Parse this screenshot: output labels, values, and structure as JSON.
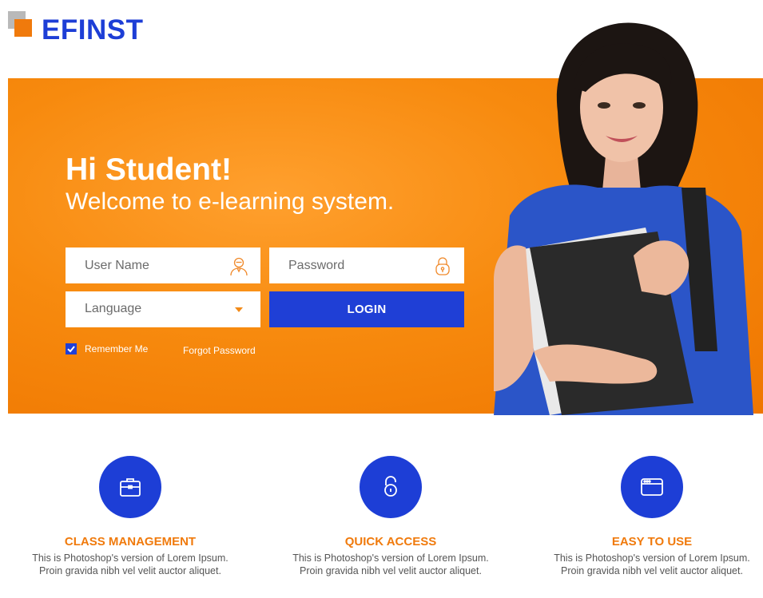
{
  "brand": {
    "name": "EFINST",
    "accent": "#f07a0c",
    "blue": "#1d3ed6"
  },
  "hero": {
    "greeting": "Hi Student!",
    "welcome": "Welcome to e-learning system.",
    "background": "#f78a0e",
    "image": "student-photo"
  },
  "form": {
    "username_placeholder": "User Name",
    "password_placeholder": "Password",
    "language_value": "Language",
    "login_label": "LOGIN",
    "remember_label": "Remember Me",
    "remember_checked": true,
    "forgot_label": "Forgot Password"
  },
  "features": [
    {
      "icon": "briefcase-icon",
      "title": "CLASS MANAGEMENT",
      "desc": "This is Photoshop's version  of Lorem Ipsum. Proin gravida nibh vel velit auctor aliquet."
    },
    {
      "icon": "unlock-icon",
      "title": "QUICK ACCESS",
      "desc": "This is Photoshop's version  of Lorem Ipsum. Proin gravida nibh vel velit auctor aliquet."
    },
    {
      "icon": "browser-window-icon",
      "title": "EASY TO USE",
      "desc": "This is Photoshop's version  of Lorem Ipsum. Proin gravida nibh vel velit auctor aliquet."
    }
  ]
}
